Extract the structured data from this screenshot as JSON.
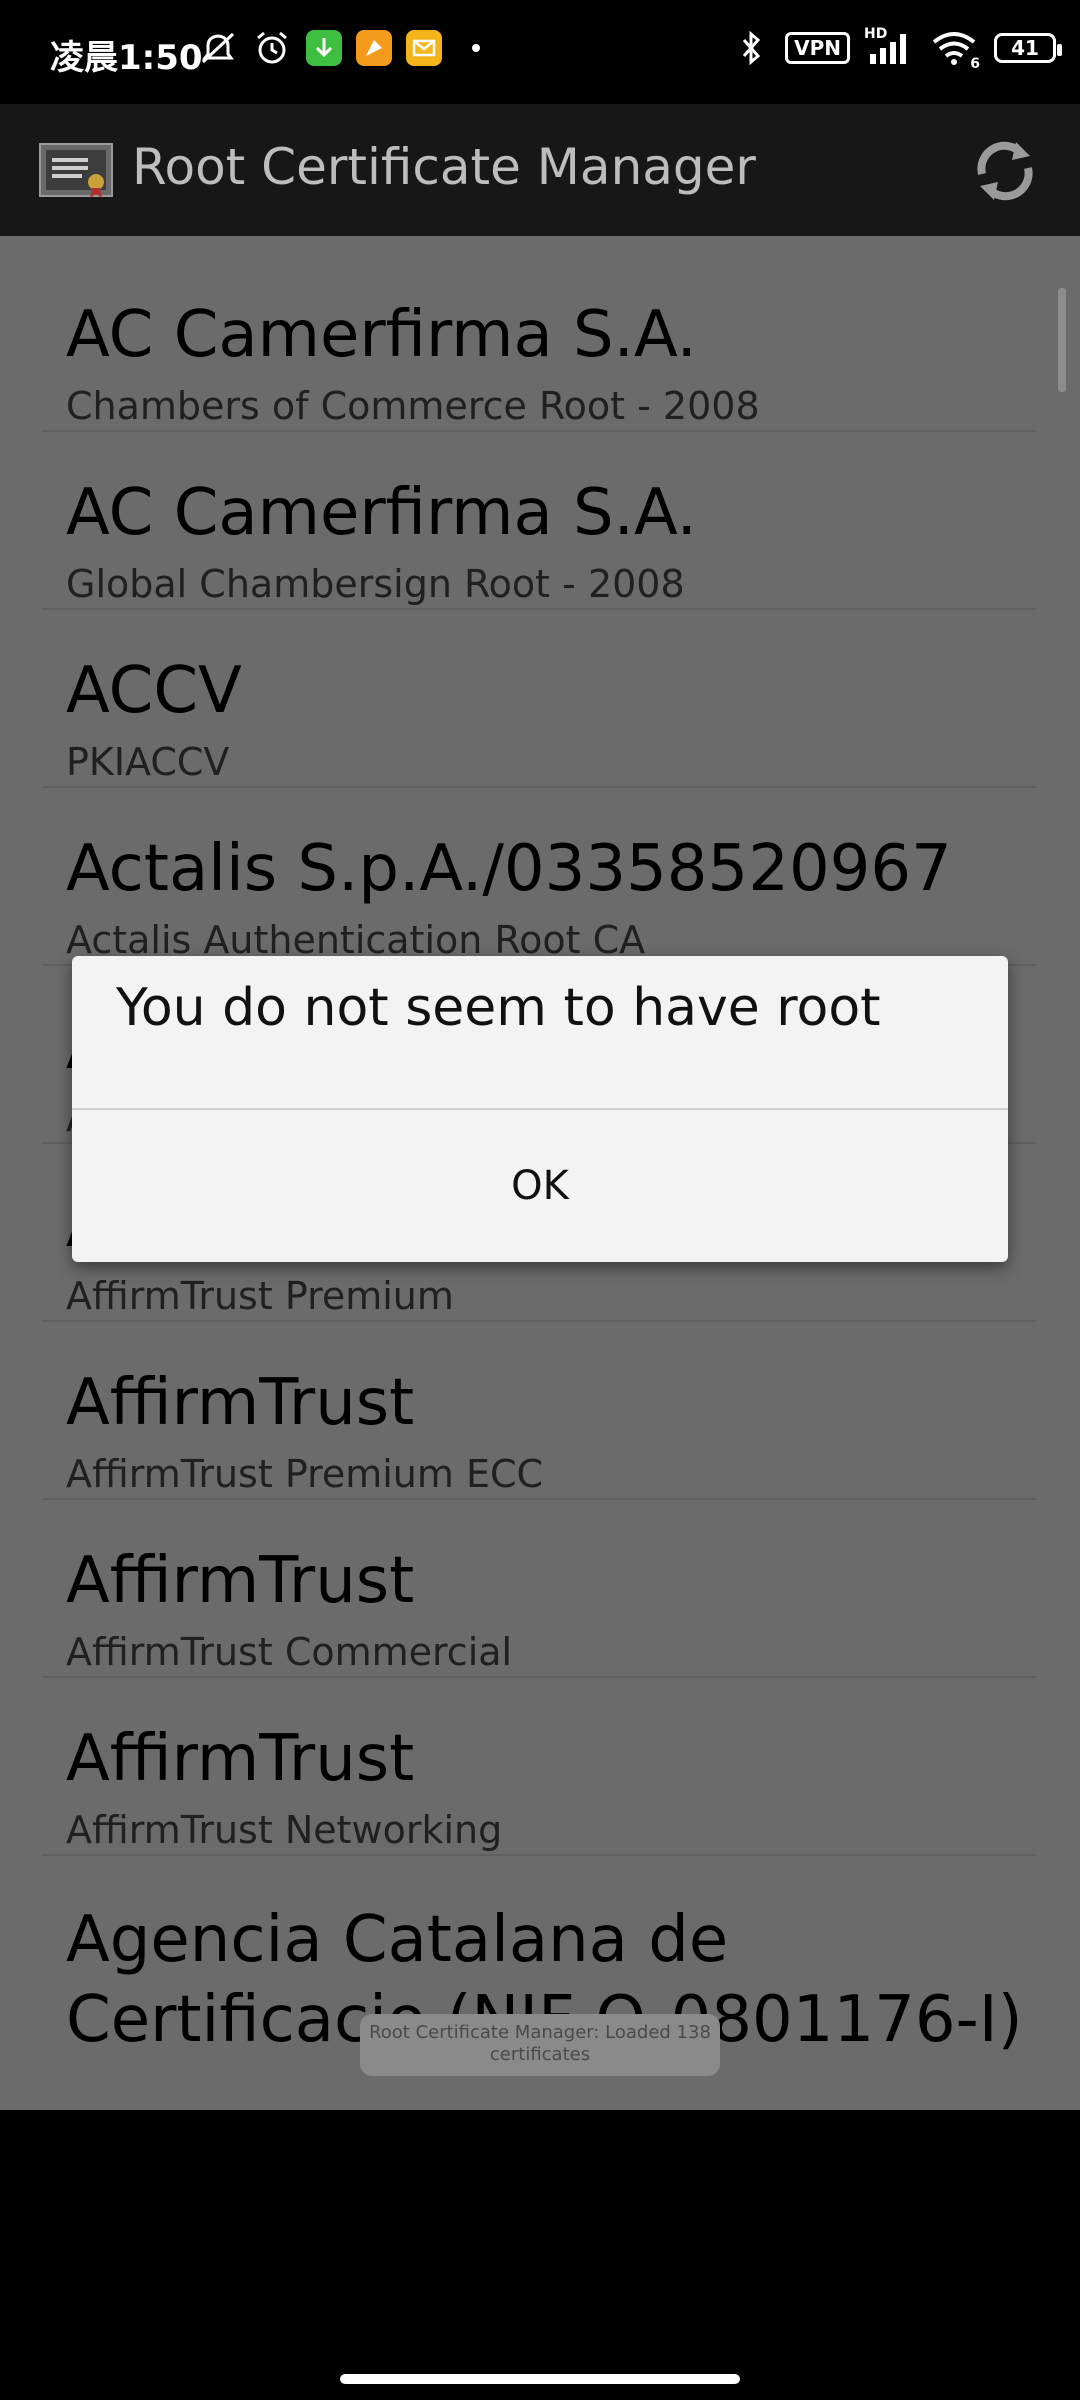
{
  "status_bar": {
    "time": "凌晨1:50",
    "vpn_label": "VPN",
    "hd_label": "HD",
    "network_label": "6",
    "battery": "41",
    "icons": [
      "mute-icon",
      "alarm-icon",
      "download-app-icon",
      "orange-app-icon",
      "mail-app-icon",
      "notification-dot",
      "bluetooth-icon",
      "signal-icon",
      "wifi-icon",
      "battery-icon"
    ]
  },
  "app_bar": {
    "title": "Root Certificate Manager",
    "icons": [
      "certificate-app-icon",
      "refresh-icon"
    ]
  },
  "certificates": [
    {
      "org": "AC Camerfirma S.A.",
      "name": "Chambers of Commerce Root - 2008"
    },
    {
      "org": "AC Camerfirma S.A.",
      "name": "Global Chambersign Root - 2008"
    },
    {
      "org": "ACCV",
      "name": "PKIACCV"
    },
    {
      "org": "Actalis S.p.A./03358520967",
      "name": "Actalis Authentication Root CA"
    },
    {
      "org": "A",
      "name": "A"
    },
    {
      "org": "A",
      "name": "AffirmTrust Premium"
    },
    {
      "org": "AffirmTrust",
      "name": "AffirmTrust Premium ECC"
    },
    {
      "org": "AffirmTrust",
      "name": "AffirmTrust Commercial"
    },
    {
      "org": "AffirmTrust",
      "name": "AffirmTrust Networking"
    },
    {
      "org": "Agencia Catalana de Certificacio (NIF Q-0801176-I)",
      "name": ""
    }
  ],
  "dialog": {
    "message": "You do not seem to have root",
    "ok_label": "OK"
  },
  "toast": {
    "text": "Root Certificate Manager: Loaded 138 certificates"
  },
  "colors": {
    "status_bar_bg": "#000000",
    "app_bar_bg": "#171717",
    "dimmed_list_bg": "#6b6b6b",
    "dialog_bg": "#f3f3f3"
  }
}
